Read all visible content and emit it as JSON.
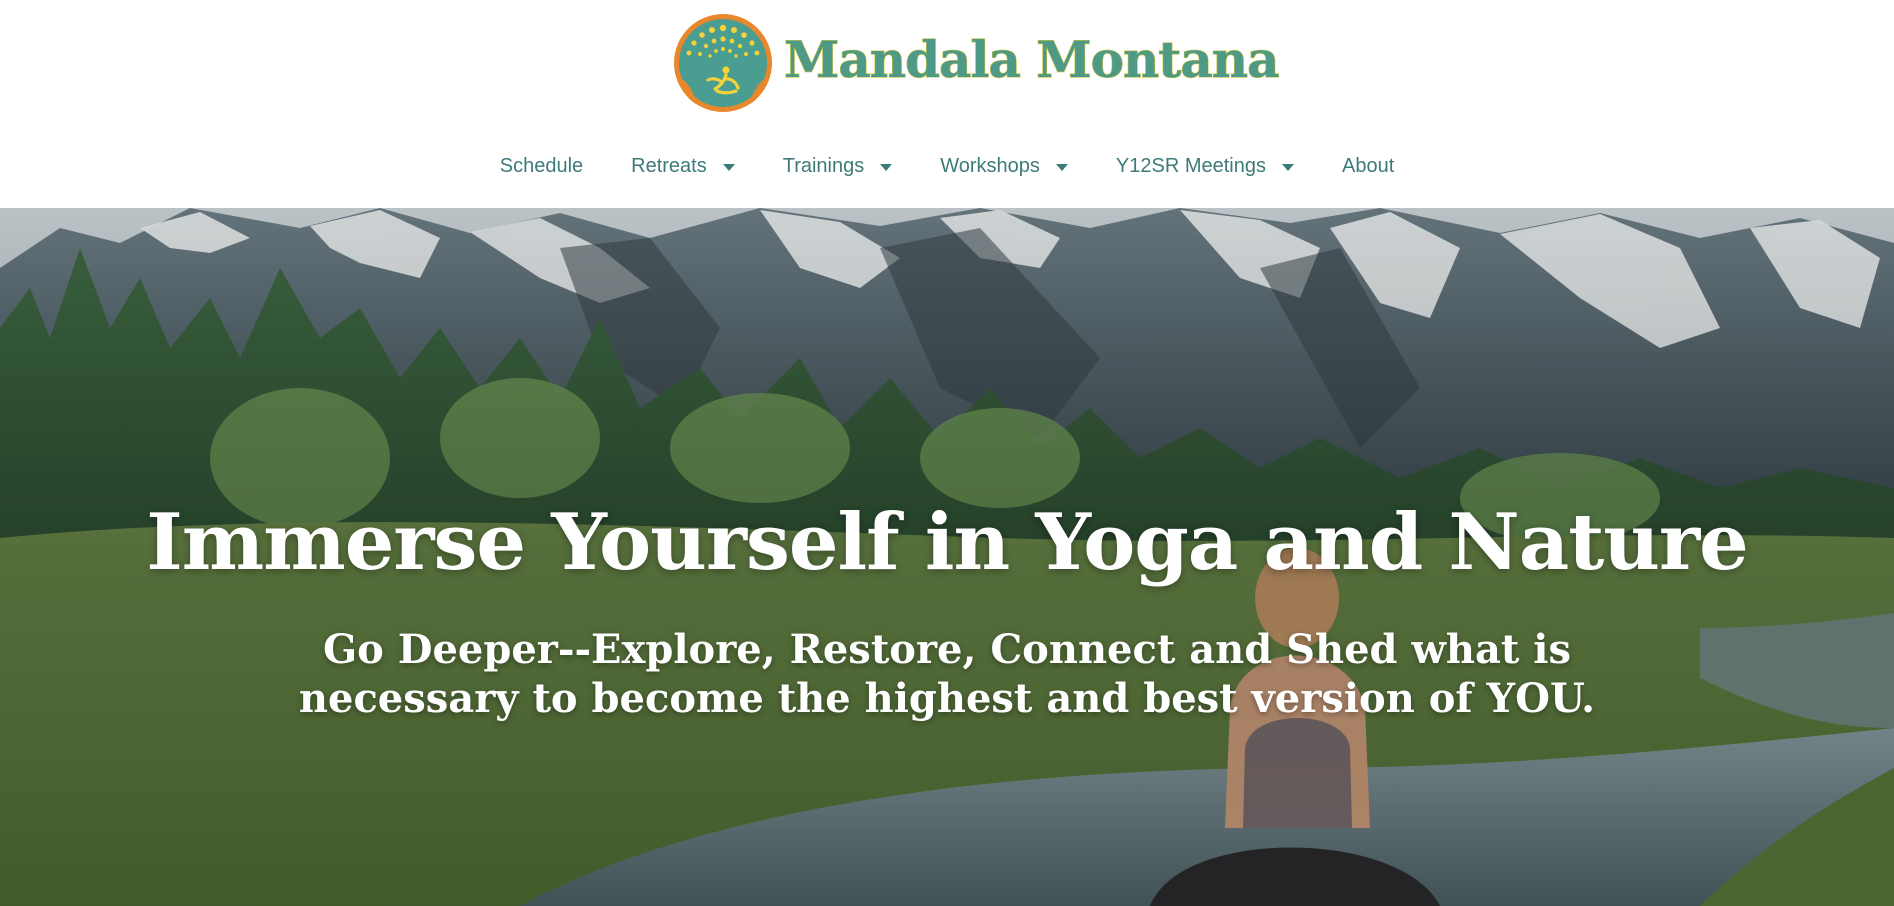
{
  "brand": {
    "name": "Mandala Montana",
    "logo_icon": "mandala-logo-icon",
    "colors": {
      "brand_teal": "#4f9a86",
      "brand_outline_yellow": "#c9c23e",
      "logo_ring_orange": "#e8872c",
      "nav_text": "#3e7a78"
    }
  },
  "nav": {
    "items": [
      {
        "label": "Schedule",
        "has_dropdown": false
      },
      {
        "label": "Retreats",
        "has_dropdown": true
      },
      {
        "label": "Trainings",
        "has_dropdown": true
      },
      {
        "label": "Workshops",
        "has_dropdown": true
      },
      {
        "label": "Y12SR Meetings",
        "has_dropdown": true
      },
      {
        "label": "About",
        "has_dropdown": false
      }
    ],
    "dropdown_icon": "caret-down-icon"
  },
  "hero": {
    "title": "Immerse Yourself in Yoga and Nature",
    "subtitle": "Go Deeper--Explore, Restore, Connect and Shed what is necessary to become the highest and best version of YOU.",
    "background_image": "mountain-river-yoga-photo"
  }
}
